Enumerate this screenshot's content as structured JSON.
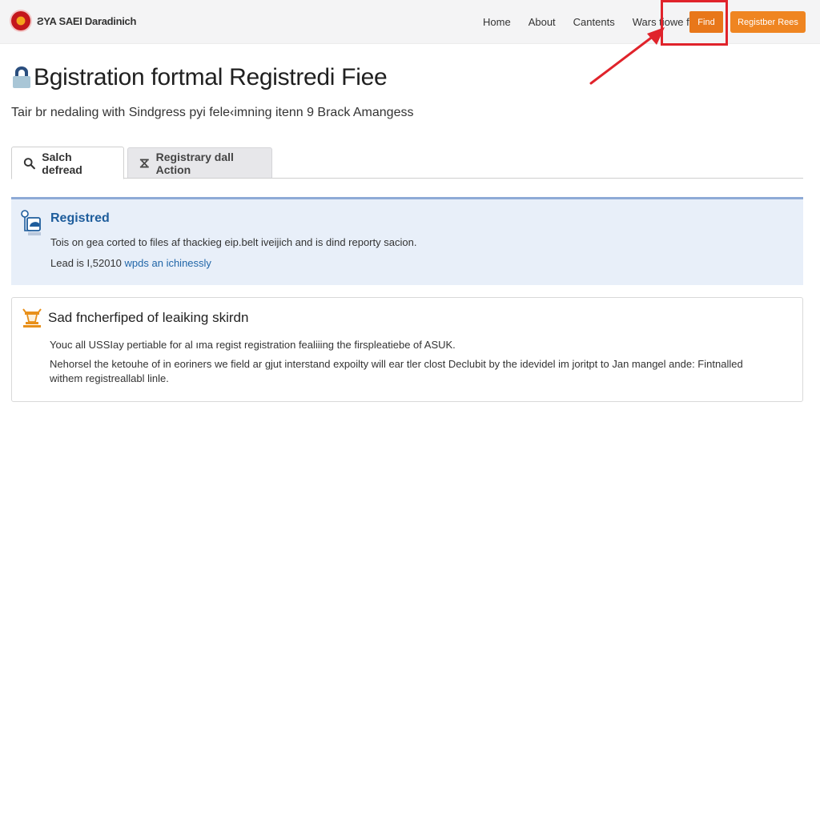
{
  "header": {
    "brand_name": "ƧYA SAEI Daradinich",
    "nav": [
      "Home",
      "About",
      "Cantents",
      "Wars tiowe fdll"
    ],
    "find_button": "Find",
    "register_button": "Registber Rees",
    "annotation_color": "#e0232b"
  },
  "page": {
    "title": "Bgistration  fortmal Registredi Fiee",
    "subtitle": "Tair br nedaling with Sindgress pyi fele‹imning itenn 9 Brack Amangess"
  },
  "tabs": [
    {
      "label": "Salch defread",
      "icon": "search-icon",
      "active": true
    },
    {
      "label": "Registrary dall Action",
      "icon": "action-icon",
      "active": false
    }
  ],
  "info_panel": {
    "title": "Registred",
    "text": "Tois on gea corted to files af thackieg eip.belt iveijich and is dind reporty sacion.",
    "meta_prefix": "Lead is I,52010",
    "meta_link": "wpds an ichinessly",
    "accent_color": "#1e5d9c"
  },
  "notice_panel": {
    "title": "Sad fncherfiped of leaiking skirdn",
    "line1": "Youc all USSIay pertiable for al ıma regist registration fealiiing the firspleatiebe of ASUK.",
    "line2": "Nehorsel the ketouhe of in eoriners we field ar gjut interstand expoilty will ear tler clost Declubit by  the idevidel im joritpt to Jan mangel ande: Fintnalled withem registreallabl linle.",
    "icon_color": "#e8901a"
  }
}
